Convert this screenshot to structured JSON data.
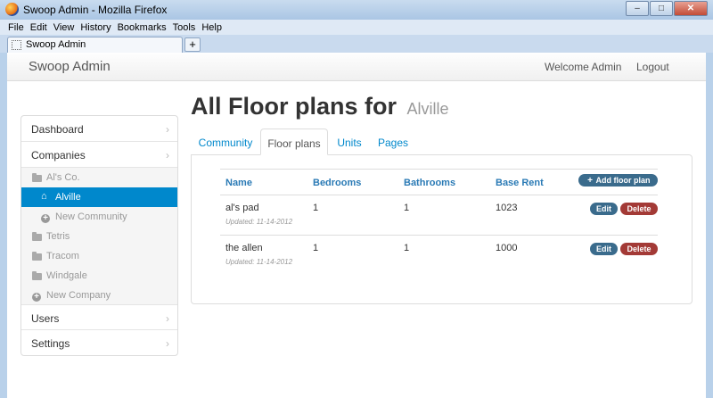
{
  "window": {
    "title": "Swoop Admin - Mozilla Firefox",
    "minimize": "–",
    "maximize": "□",
    "close": "✕"
  },
  "menubar": [
    "File",
    "Edit",
    "View",
    "History",
    "Bookmarks",
    "Tools",
    "Help"
  ],
  "browser_tab": {
    "title": "Swoop Admin",
    "new_tab": "+"
  },
  "navbar": {
    "brand": "Swoop Admin",
    "welcome": "Welcome Admin",
    "logout": "Logout"
  },
  "sidebar": {
    "items": [
      "Dashboard",
      "Companies",
      "Users",
      "Settings"
    ],
    "sub_items": [
      "Al's Co.",
      "Alville",
      "New Community",
      "Tetris",
      "Tracom",
      "Windgale",
      "New Company"
    ],
    "chevron": "›",
    "home_icon": "⌂",
    "plus_icon": "+"
  },
  "page": {
    "title": "All Floor plans for",
    "subtitle": "Alville"
  },
  "tabs": [
    "Community",
    "Floor plans",
    "Units",
    "Pages"
  ],
  "table": {
    "headers": [
      "Name",
      "Bedrooms",
      "Bathrooms",
      "Base Rent"
    ],
    "add_button": "Add floor plan",
    "add_icon": "+",
    "rows": [
      {
        "name": "al's pad",
        "updated": "Updated: 11-14-2012",
        "bedrooms": "1",
        "bathrooms": "1",
        "rent": "1023"
      },
      {
        "name": "the allen",
        "updated": "Updated: 11-14-2012",
        "bedrooms": "1",
        "bathrooms": "1",
        "rent": "1000"
      }
    ],
    "edit_label": "Edit",
    "delete_label": "Delete"
  },
  "colors": {
    "active": "#0088cc",
    "edit": "#3a6b8c",
    "delete": "#a33a36",
    "link": "#2a7ab5"
  }
}
